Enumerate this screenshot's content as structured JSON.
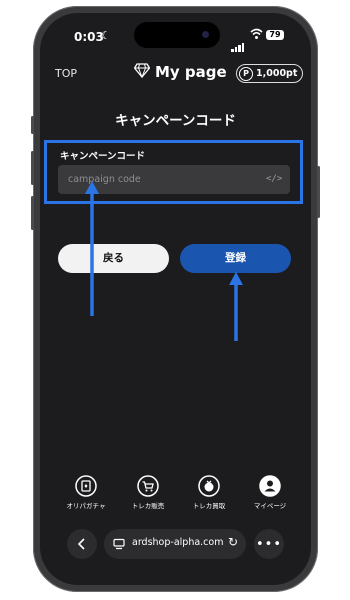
{
  "status_bar": {
    "time": "0:03",
    "battery": "79"
  },
  "header": {
    "top_link": "TOP",
    "title": "My page",
    "points_symbol": "P",
    "points_value": "1,000pt"
  },
  "page": {
    "title": "キャンペーンコード",
    "field_label": "キャンペーンコード",
    "input_placeholder": "campaign code",
    "input_value": "",
    "back_button": "戻る",
    "register_button": "登録"
  },
  "annotation": {
    "highlight_color": "#2b74e6",
    "arrow_color": "#2b74e6"
  },
  "bottom_nav": {
    "items": [
      {
        "label": "オリパガチャ",
        "icon": "card-icon"
      },
      {
        "label": "トレカ販売",
        "icon": "cart-icon"
      },
      {
        "label": "トレカ買取",
        "icon": "buyback-icon"
      },
      {
        "label": "マイページ",
        "icon": "user-icon"
      }
    ]
  },
  "browser": {
    "url": "ardshop-alpha.com"
  },
  "colors": {
    "accent": "#1a56b0",
    "background": "#1c1c1e"
  }
}
